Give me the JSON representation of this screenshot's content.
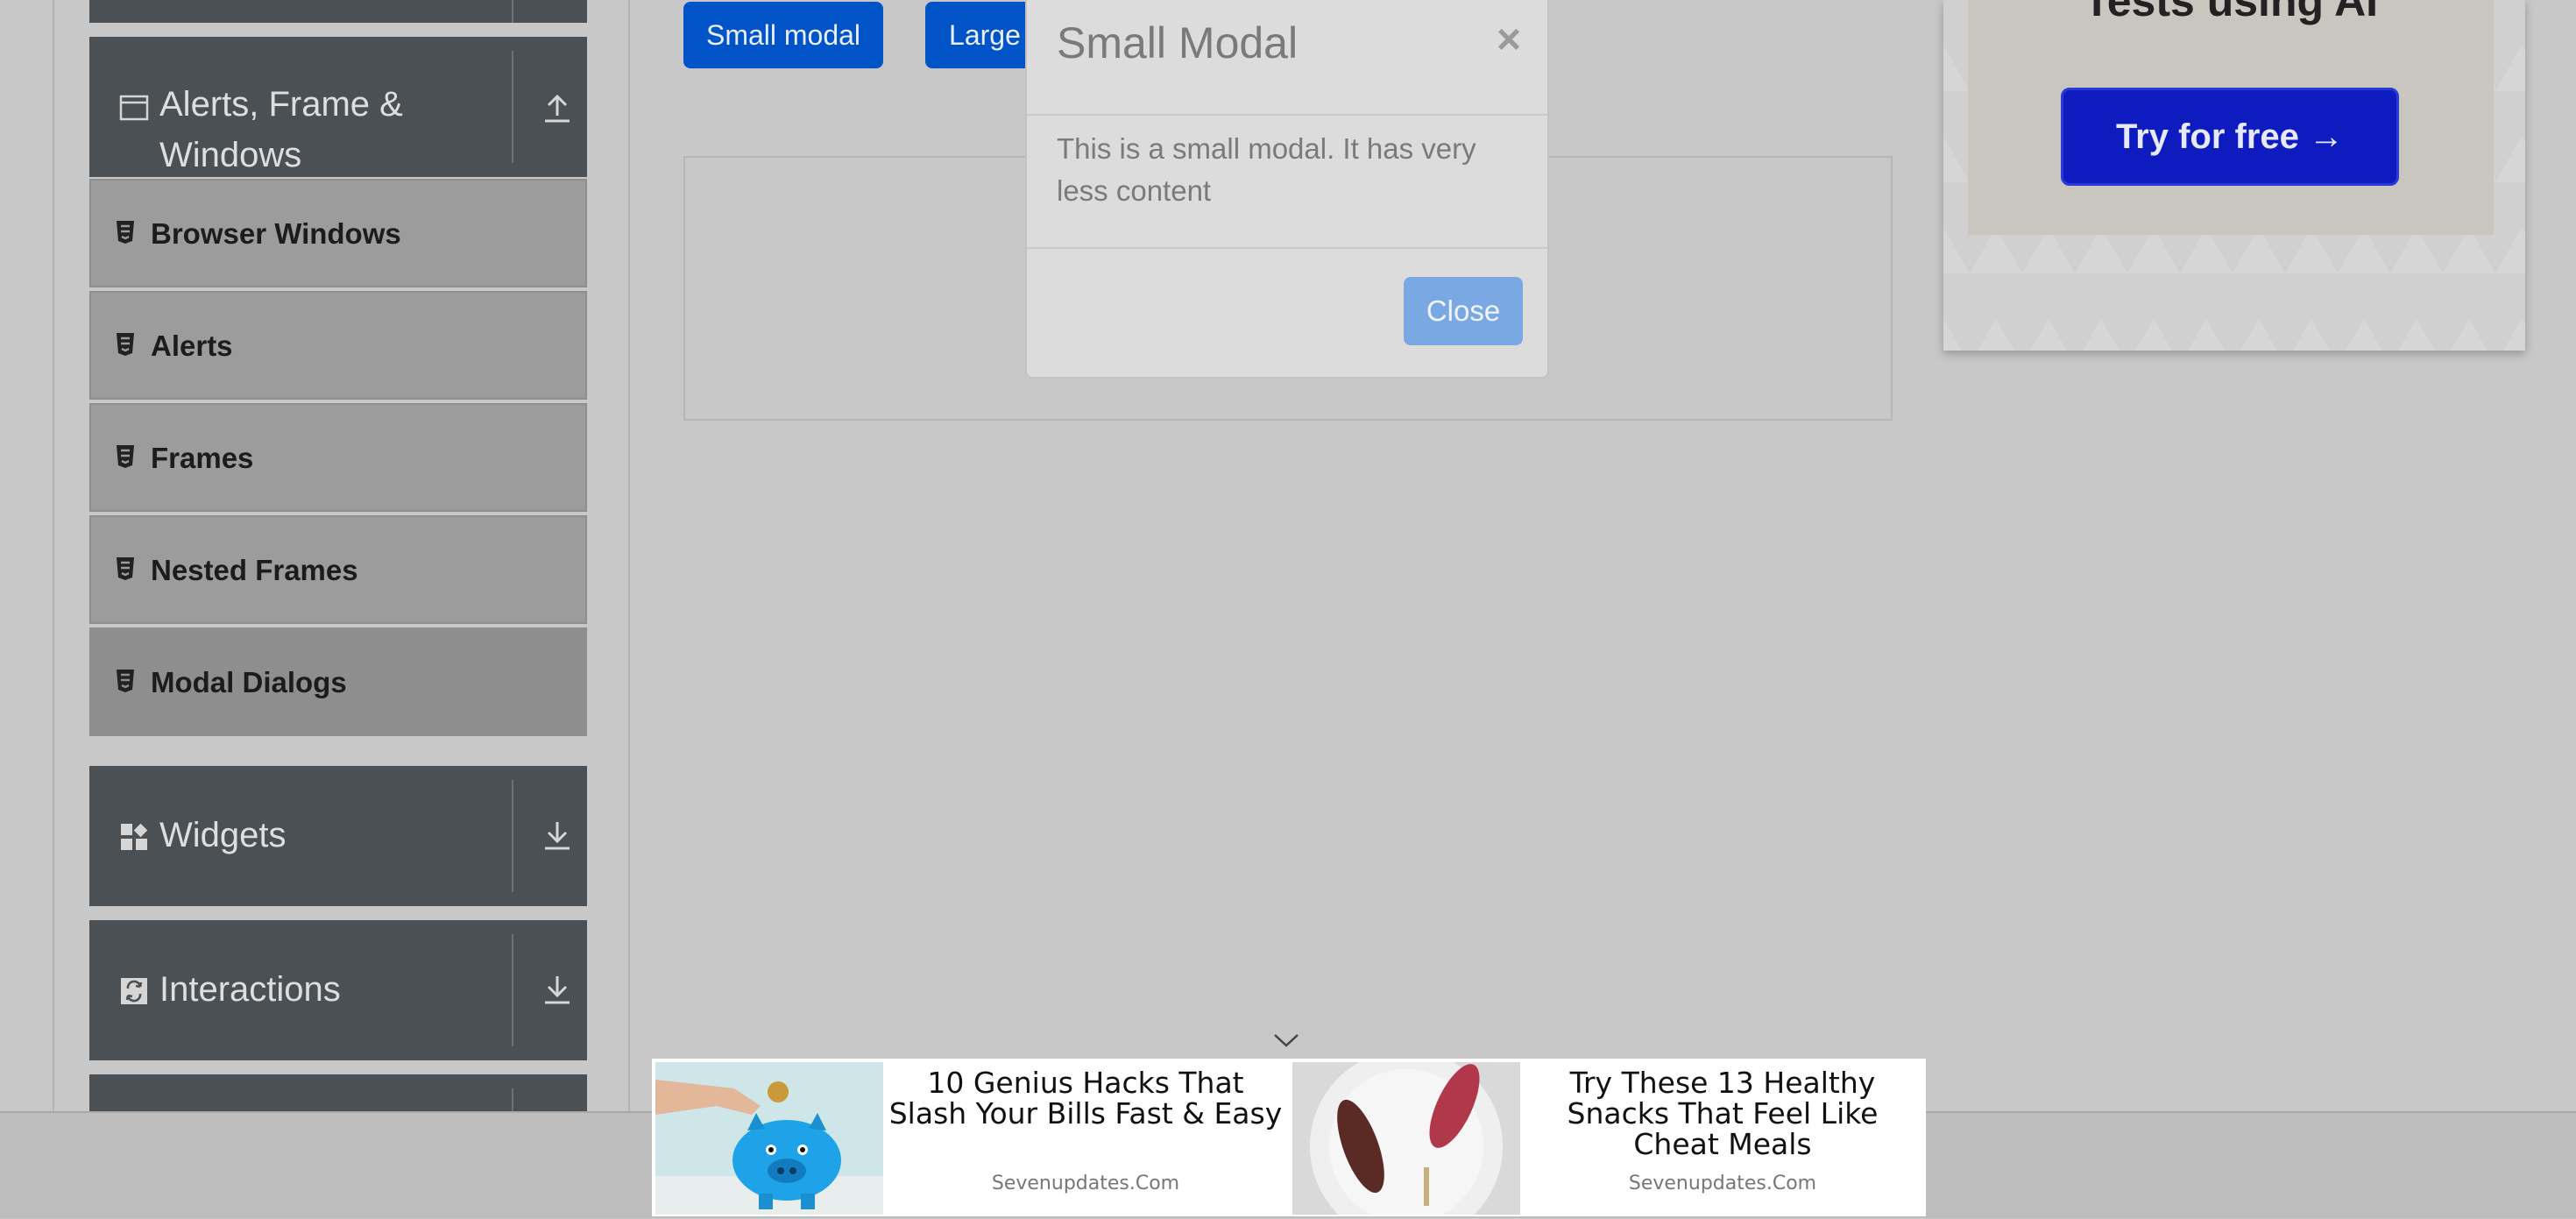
{
  "sidebar": {
    "groups": {
      "alerts": {
        "title": "Alerts, Frame & Windows",
        "icon": "window-icon",
        "toggle_icon": "collapse-upload-icon"
      },
      "widgets": {
        "title": "Widgets",
        "icon": "widgets-icon",
        "toggle_icon": "expand-download-icon"
      },
      "interactions": {
        "title": "Interactions",
        "icon": "interactions-icon",
        "toggle_icon": "expand-download-icon"
      }
    },
    "items": [
      {
        "label": "Browser Windows",
        "icon": "html5-icon"
      },
      {
        "label": "Alerts",
        "icon": "html5-icon"
      },
      {
        "label": "Frames",
        "icon": "html5-icon"
      },
      {
        "label": "Nested Frames",
        "icon": "html5-icon"
      },
      {
        "label": "Modal Dialogs",
        "icon": "html5-icon",
        "active": true
      }
    ]
  },
  "main": {
    "small_modal_button": "Small modal",
    "large_modal_button": "Large modal"
  },
  "modal": {
    "title": "Small Modal",
    "close_symbol": "×",
    "body": "This is a small modal. It has very less content",
    "close_button": "Close"
  },
  "ad_right": {
    "heading": "Tests using AI",
    "cta": "Try for free →",
    "cta_color": "#0d1bbf"
  },
  "bottom_ads": [
    {
      "headline": "10 Genius Hacks That Slash Your Bills Fast & Easy",
      "source": "Sevenupdates.Com",
      "image": "piggy-bank-image"
    },
    {
      "headline": "Try These 13 Healthy Snacks That Feel Like Cheat Meals",
      "source": "Sevenupdates.Com",
      "image": "chocolate-snack-image"
    }
  ],
  "colors": {
    "overlay_background": "#c8c8c8",
    "sidebar_group": "#4b5055",
    "primary_button": "#0054c7"
  }
}
